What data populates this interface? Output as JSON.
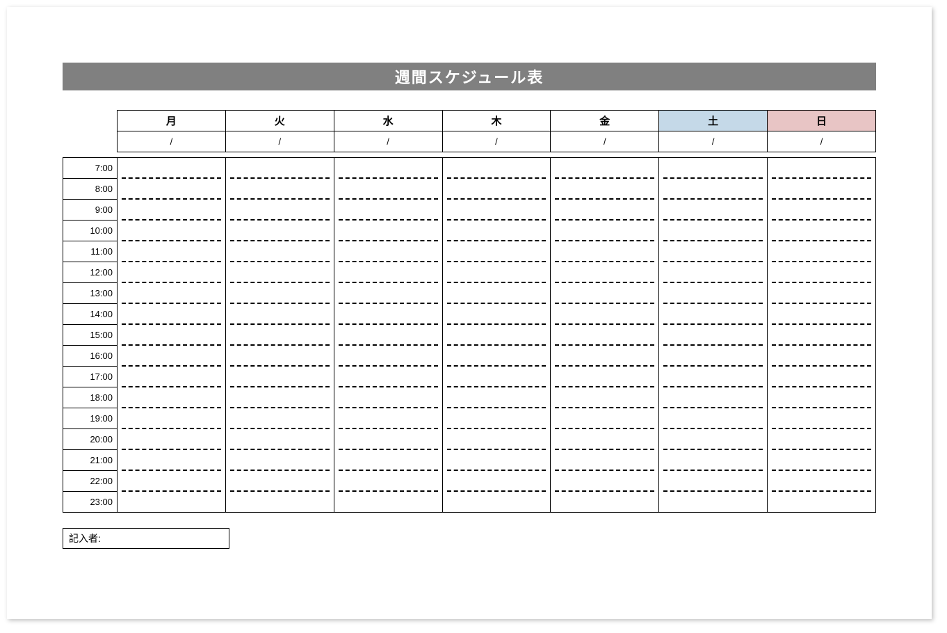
{
  "title": "週間スケジュール表",
  "days": [
    "月",
    "火",
    "水",
    "木",
    "金",
    "土",
    "日"
  ],
  "dates": [
    "/",
    "/",
    "/",
    "/",
    "/",
    "/",
    "/"
  ],
  "times": [
    "7:00",
    "8:00",
    "9:00",
    "10:00",
    "11:00",
    "12:00",
    "13:00",
    "14:00",
    "15:00",
    "16:00",
    "17:00",
    "18:00",
    "19:00",
    "20:00",
    "21:00",
    "22:00",
    "23:00"
  ],
  "author_label": "記入者:",
  "colors": {
    "title_bg": "#808080",
    "sat_bg": "#c5d9e8",
    "sun_bg": "#e8c5c5"
  }
}
